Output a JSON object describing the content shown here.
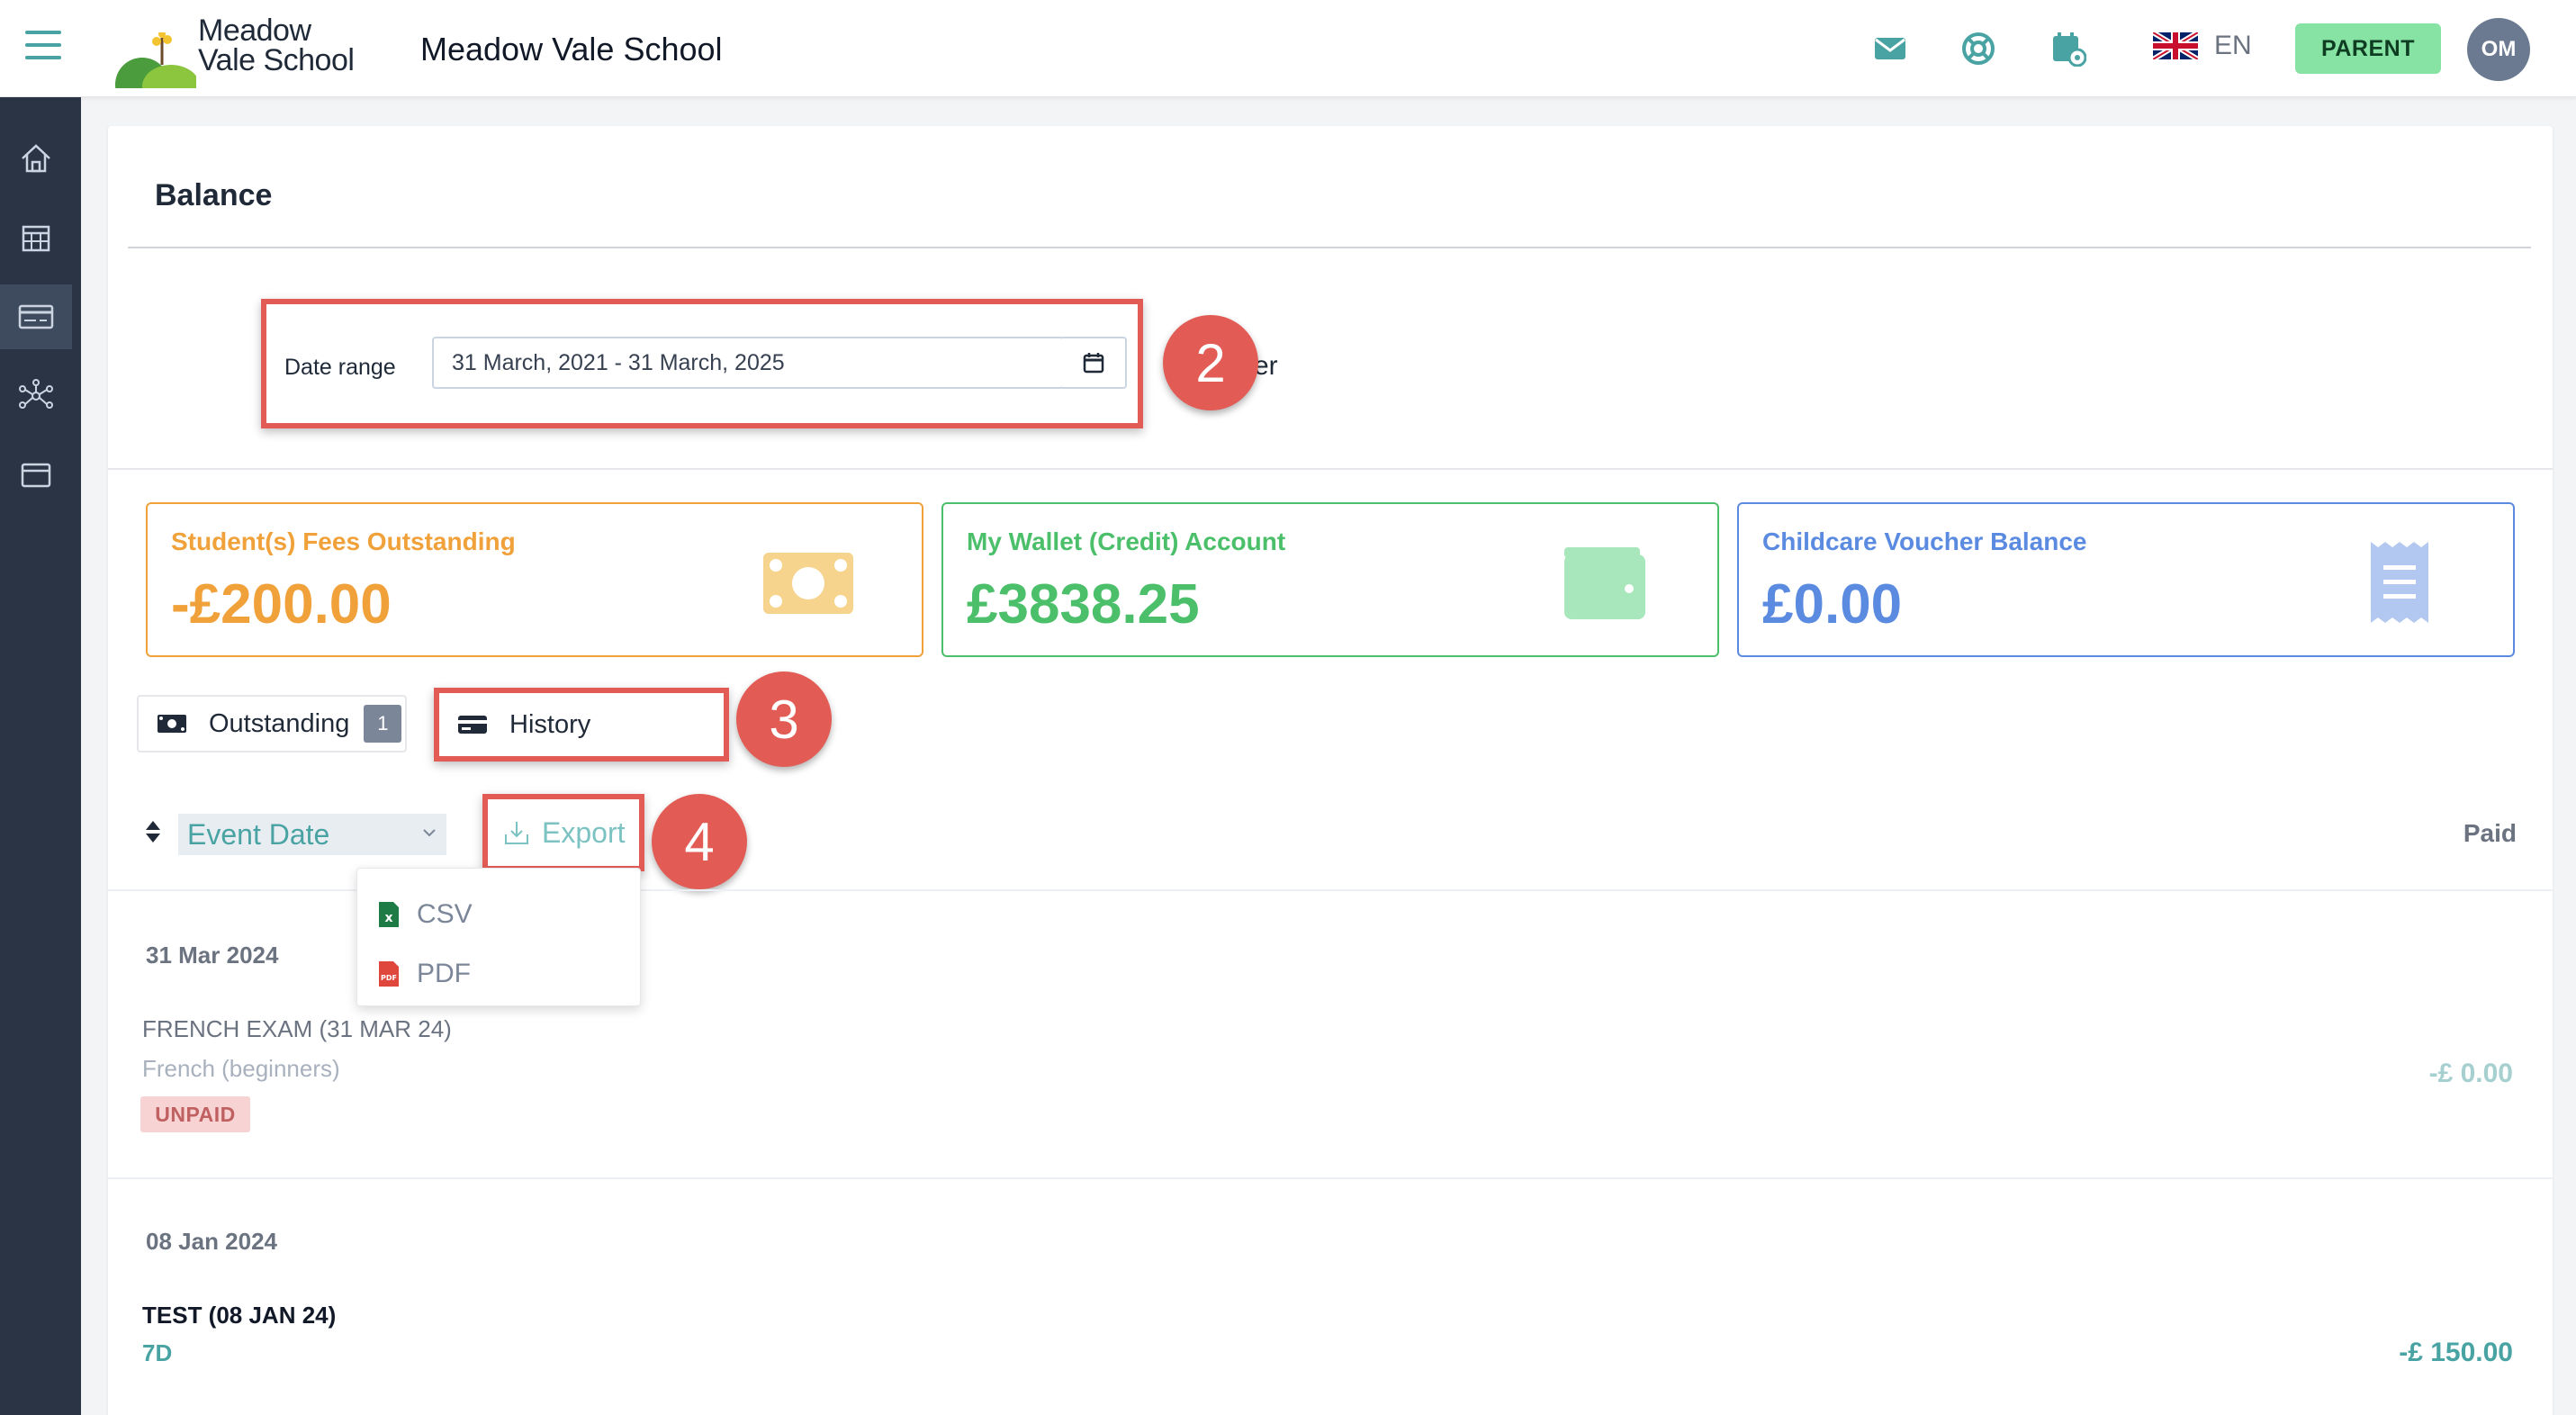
{
  "app": {
    "logo_line1": "Meadow",
    "logo_line2": "Vale School",
    "school_name": "Meadow Vale School",
    "language": "EN",
    "role": "PARENT",
    "avatar_initials": "OM"
  },
  "icons": {
    "menu": "hamburger-icon",
    "mail": "mail-icon",
    "support": "lifebuoy-icon",
    "calendar_settings": "calendar-gear-icon",
    "flag": "uk-flag-icon",
    "sidebar": [
      "home-icon",
      "calendar-icon",
      "card-icon",
      "network-icon",
      "window-icon"
    ]
  },
  "page": {
    "title": "Balance",
    "date_range_label": "Date range",
    "date_range_value": "31 March, 2021 - 31 March, 2025",
    "filter_text": "lter",
    "annotations": [
      "2",
      "3",
      "4"
    ]
  },
  "summary": [
    {
      "title": "Student(s) Fees Outstanding",
      "value": "-£200.00",
      "color": "#f0a13a",
      "icon": "cash-icon"
    },
    {
      "title": "My Wallet (Credit) Account",
      "value": "£3838.25",
      "color": "#4cbf6b",
      "icon": "wallet-icon"
    },
    {
      "title": "Childcare Voucher Balance",
      "value": "£0.00",
      "color": "#5b8be0",
      "icon": "receipt-icon"
    }
  ],
  "tabs": {
    "outstanding_label": "Outstanding",
    "outstanding_count": "1",
    "history_label": "History"
  },
  "toolbar": {
    "sort_field": "Event Date",
    "export_label": "Export",
    "paid_header": "Paid",
    "export_options": [
      "CSV",
      "PDF"
    ]
  },
  "rows": [
    {
      "date": "31 Mar 2024",
      "title": "FRENCH EXAM (31 MAR 24)",
      "subtitle": "French (beginners)",
      "status": "UNPAID",
      "amount": "-£ 0.00"
    },
    {
      "date": "08 Jan 2024",
      "title": "TEST (08 JAN 24)",
      "subtitle": "7D",
      "amount": "-£ 150.00"
    }
  ],
  "colors": {
    "accent": "#4aa3a3",
    "sidebar": "#2b3445",
    "highlight": "#e25c55",
    "role_button": "#86e3a4"
  }
}
